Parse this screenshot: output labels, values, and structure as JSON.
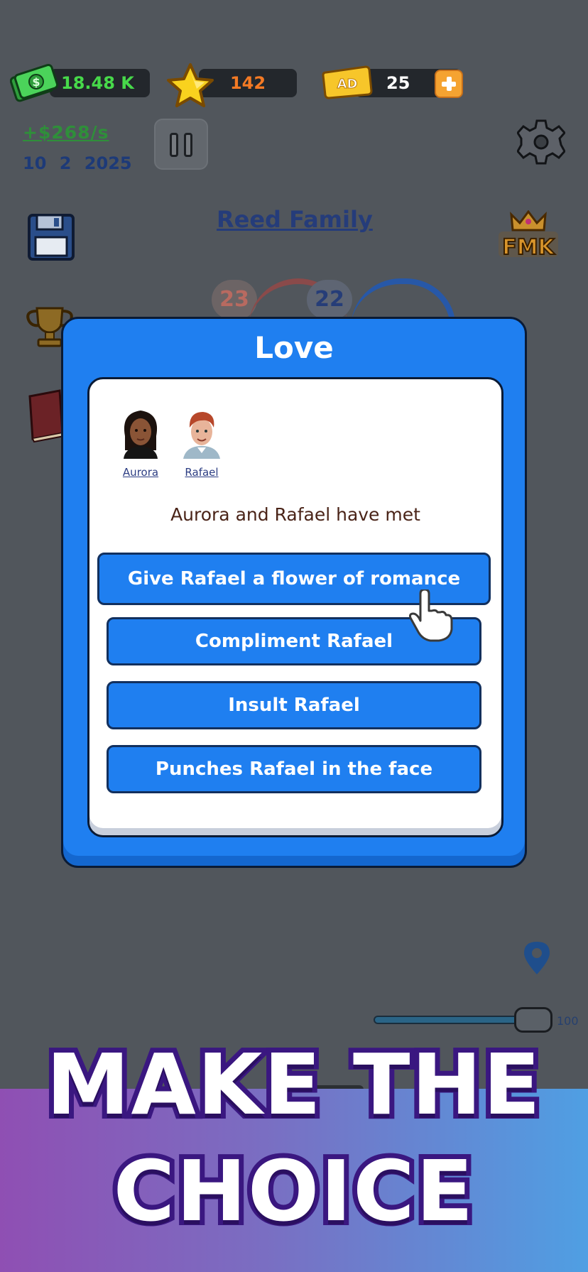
{
  "hud": {
    "cash": "18.48 K",
    "stars": "142",
    "ad_tickets": "25",
    "ad_icon_text": "AD",
    "income": "+$268/s",
    "date": "10  2  2025"
  },
  "family": {
    "title": "Reed Family",
    "left_age": "23",
    "right_age": "22"
  },
  "modal": {
    "title": "Love",
    "people": [
      {
        "name": "Aurora"
      },
      {
        "name": "Rafael"
      }
    ],
    "event": "Aurora and Rafael have met",
    "choices": [
      "Give Rafael a flower of romance",
      "Compliment Rafael",
      "Insult Rafael",
      "Punches Rafael in the face"
    ]
  },
  "slider": {
    "value": "100"
  },
  "banner": {
    "line1": "MAKE THE",
    "line2": "CHOICE"
  },
  "icons": [
    "cash-icon",
    "star-icon",
    "ad-ticket-icon",
    "plus-icon",
    "pause-icon",
    "gear-icon",
    "floppy-save-icon",
    "fmk-crown-icon",
    "trophy-icon",
    "book-icon",
    "map-pin-icon",
    "pointing-hand-icon"
  ],
  "colors": {
    "modal_blue": "#1f7ff0",
    "cash_green": "#47d94a",
    "star_orange": "#f47a24",
    "banner_purple": "#8f4fb3",
    "banner_blue": "#4f9fe3"
  }
}
